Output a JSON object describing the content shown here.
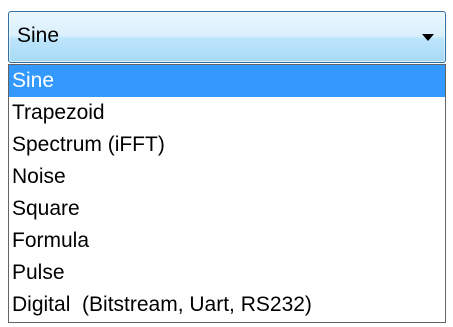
{
  "combo": {
    "value": "Sine",
    "arrow_icon": "chevron-down-icon"
  },
  "options": [
    "Sine",
    "Trapezoid",
    "Spectrum (iFFT)",
    "Noise",
    "Square",
    "Formula",
    "Pulse",
    "Digital  (Bitstream, Uart, RS232)"
  ],
  "selected_index": 0,
  "colors": {
    "highlight": "#3399ff",
    "highlight_text": "#ffffff",
    "combo_border": "#2e6fa6"
  }
}
